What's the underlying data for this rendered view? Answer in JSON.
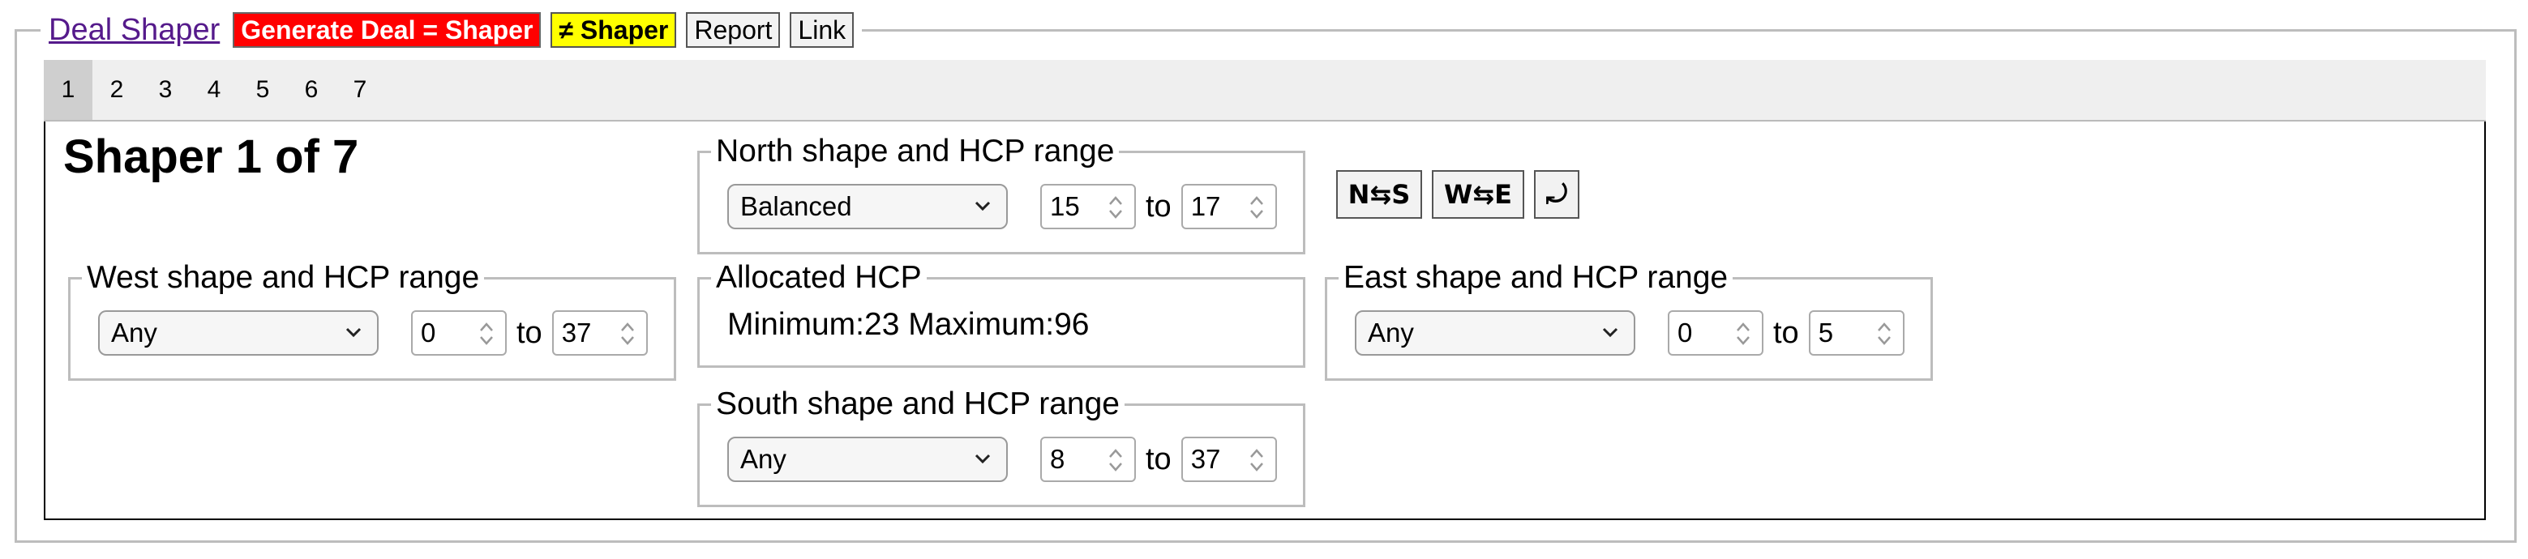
{
  "header": {
    "app_title": "Deal Shaper",
    "generate_label": "Generate Deal = Shaper",
    "not_shaper_label": "≠ Shaper",
    "report_label": "Report",
    "link_label": "Link"
  },
  "tabs": [
    "1",
    "2",
    "3",
    "4",
    "5",
    "6",
    "7"
  ],
  "active_tab": "1",
  "panel": {
    "heading": "Shaper 1 of 7",
    "north": {
      "legend": "North shape and HCP range",
      "shape": "Balanced",
      "min": "15",
      "to": "to",
      "max": "17"
    },
    "west": {
      "legend": "West shape and HCP range",
      "shape": "Any",
      "min": "0",
      "to": "to",
      "max": "37"
    },
    "east": {
      "legend": "East shape and HCP range",
      "shape": "Any",
      "min": "0",
      "to": "to",
      "max": "5"
    },
    "south": {
      "legend": "South shape and HCP range",
      "shape": "Any",
      "min": "8",
      "to": "to",
      "max": "37"
    },
    "allocated": {
      "legend": "Allocated HCP",
      "text": "Minimum:23 Maximum:96"
    },
    "swap_ns_label": "N⇆S",
    "swap_we_label": "W⇆E",
    "rotate_label": "⤾"
  }
}
